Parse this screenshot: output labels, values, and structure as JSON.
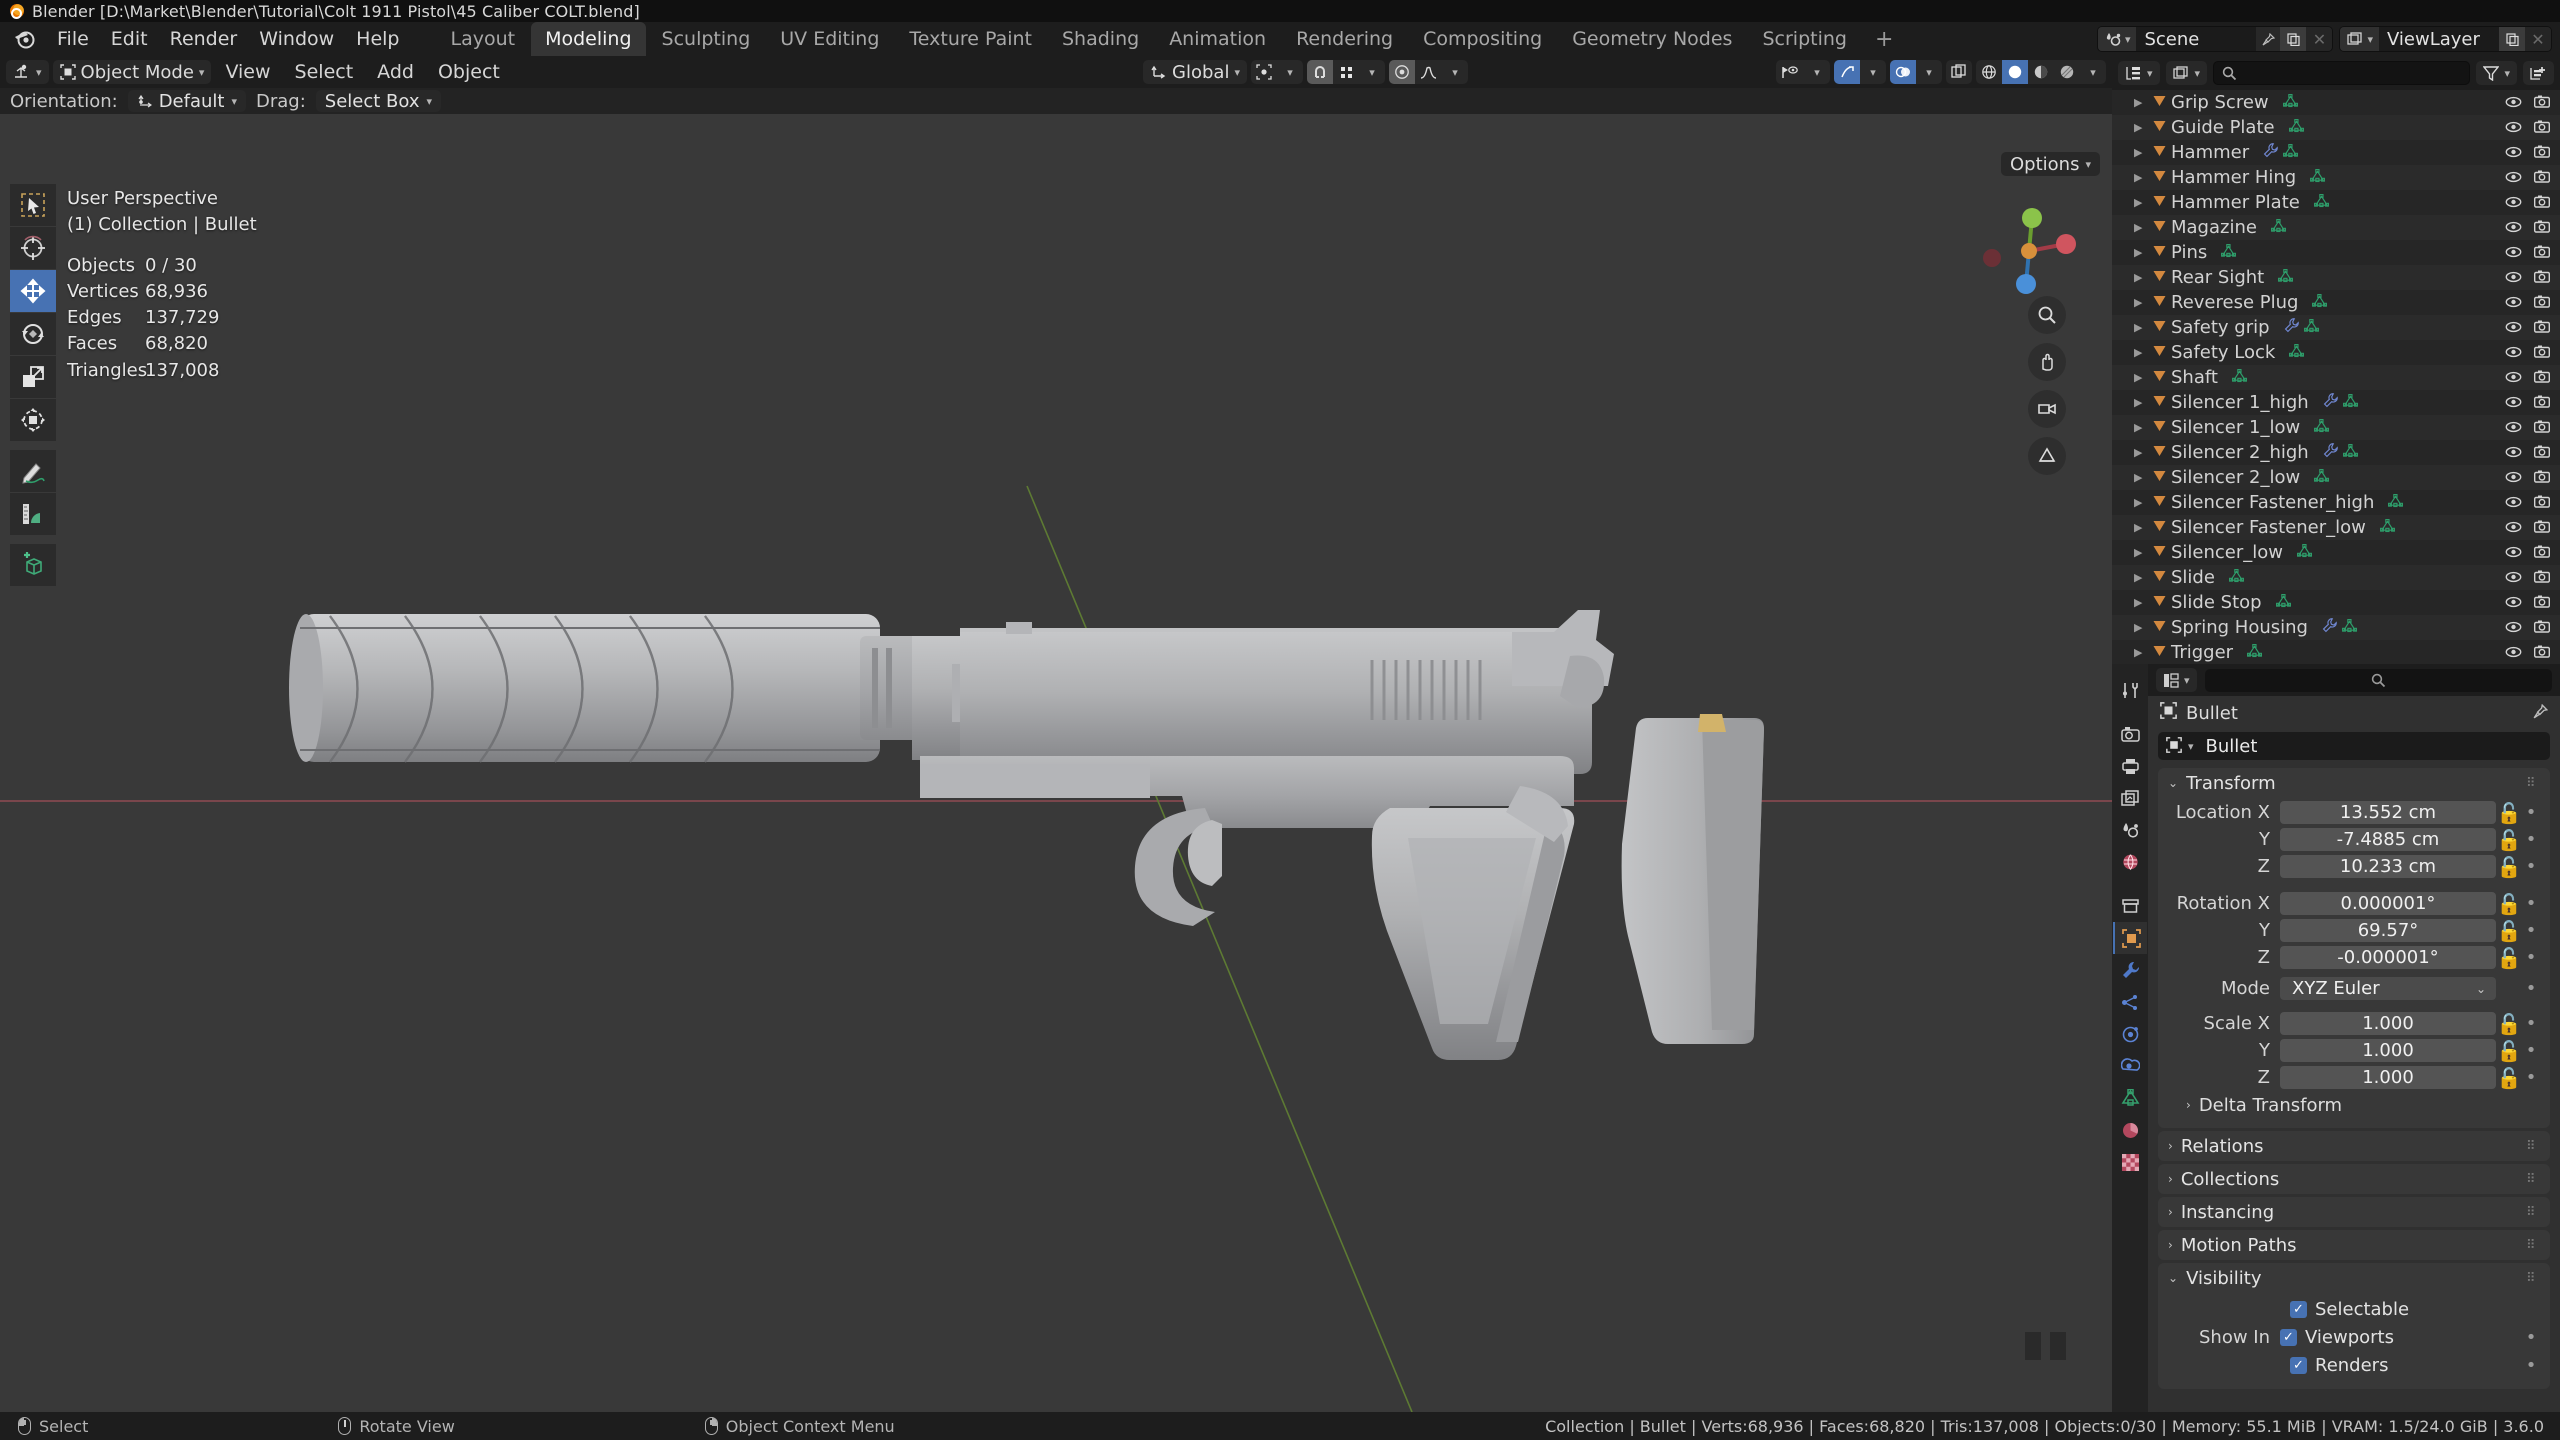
{
  "window": {
    "title": "Blender [D:\\Market\\Blender\\Tutorial\\Colt 1911 Pistol\\45 Caliber COLT.blend]"
  },
  "topbar": {
    "menus": [
      "File",
      "Edit",
      "Render",
      "Window",
      "Help"
    ],
    "workspaces": [
      "Layout",
      "Modeling",
      "Sculpting",
      "UV Editing",
      "Texture Paint",
      "Shading",
      "Animation",
      "Rendering",
      "Compositing",
      "Geometry Nodes",
      "Scripting"
    ],
    "active_workspace": "Modeling",
    "add_workspace": "+",
    "scene_name": "Scene",
    "viewlayer_name": "ViewLayer"
  },
  "viewport": {
    "header": {
      "mode": "Object Mode",
      "menus": [
        "View",
        "Select",
        "Add",
        "Object"
      ],
      "orientation_value": "Global"
    },
    "tool_settings": {
      "orientation_label": "Orientation:",
      "orientation_value": "Default",
      "drag_label": "Drag:",
      "drag_value": "Select Box"
    },
    "options_label": "Options",
    "overlay": {
      "perspective": "User Perspective",
      "collection": "(1) Collection | Bullet",
      "stats": [
        {
          "key": "Objects",
          "value": "0 / 30"
        },
        {
          "key": "Vertices",
          "value": "68,936"
        },
        {
          "key": "Edges",
          "value": "137,729"
        },
        {
          "key": "Faces",
          "value": "68,820"
        },
        {
          "key": "Triangles",
          "value": "137,008"
        }
      ]
    },
    "tools": [
      {
        "name": "tweak-select-tool",
        "active": false
      },
      {
        "name": "cursor-tool",
        "active": false
      },
      {
        "name": "move-tool",
        "active": true
      },
      {
        "name": "rotate-tool",
        "active": false
      },
      {
        "name": "scale-tool",
        "active": false
      },
      {
        "name": "transform-tool",
        "active": false
      },
      {
        "name": "annotate-tool",
        "active": false
      },
      {
        "name": "measure-tool",
        "active": false
      },
      {
        "name": "add-cube-tool",
        "active": false
      }
    ]
  },
  "outliner": {
    "search_placeholder": "",
    "items": [
      {
        "name": "Grip Screw",
        "modifier": false
      },
      {
        "name": "Guide Plate",
        "modifier": false
      },
      {
        "name": "Hammer",
        "modifier": true
      },
      {
        "name": "Hammer Hing",
        "modifier": false
      },
      {
        "name": "Hammer Plate",
        "modifier": false
      },
      {
        "name": "Magazine",
        "modifier": false
      },
      {
        "name": "Pins",
        "modifier": false
      },
      {
        "name": "Rear Sight",
        "modifier": false
      },
      {
        "name": "Reverese Plug",
        "modifier": false
      },
      {
        "name": "Safety grip",
        "modifier": true
      },
      {
        "name": "Safety Lock",
        "modifier": false
      },
      {
        "name": "Shaft",
        "modifier": false
      },
      {
        "name": "Silencer 1_high",
        "modifier": true
      },
      {
        "name": "Silencer 1_low",
        "modifier": false
      },
      {
        "name": "Silencer 2_high",
        "modifier": true
      },
      {
        "name": "Silencer 2_low",
        "modifier": false
      },
      {
        "name": "Silencer Fastener_high",
        "modifier": false
      },
      {
        "name": "Silencer Fastener_low",
        "modifier": false
      },
      {
        "name": "Silencer_low",
        "modifier": false
      },
      {
        "name": "Slide",
        "modifier": false
      },
      {
        "name": "Slide Stop",
        "modifier": false
      },
      {
        "name": "Spring Housing",
        "modifier": true
      },
      {
        "name": "Trigger",
        "modifier": false
      }
    ]
  },
  "properties": {
    "breadcrumb_object": "Bullet",
    "id_name": "Bullet",
    "transform": {
      "title": "Transform",
      "location_label": "Location X",
      "location": [
        {
          "axis": "Location X",
          "value": "13.552 cm"
        },
        {
          "axis": "Y",
          "value": "-7.4885 cm"
        },
        {
          "axis": "Z",
          "value": "10.233 cm"
        }
      ],
      "rotation": [
        {
          "axis": "Rotation X",
          "value": "0.000001°"
        },
        {
          "axis": "Y",
          "value": "69.57°"
        },
        {
          "axis": "Z",
          "value": "-0.000001°"
        }
      ],
      "mode_label": "Mode",
      "mode_value": "XYZ Euler",
      "scale": [
        {
          "axis": "Scale X",
          "value": "1.000"
        },
        {
          "axis": "Y",
          "value": "1.000"
        },
        {
          "axis": "Z",
          "value": "1.000"
        }
      ],
      "delta_transform": "Delta Transform"
    },
    "panels": [
      "Relations",
      "Collections",
      "Instancing",
      "Motion Paths"
    ],
    "visibility": {
      "title": "Visibility",
      "selectable_label": "Selectable",
      "show_in_label": "Show In",
      "viewports_label": "Viewports",
      "renders_label": "Renders"
    }
  },
  "statusbar": {
    "left": [
      {
        "icon": "mouse-left-icon",
        "label": "Select"
      },
      {
        "icon": "mouse-middle-icon",
        "label": "Rotate View"
      },
      {
        "icon": "mouse-right-icon",
        "label": "Object Context Menu"
      }
    ],
    "right": "Collection | Bullet | Verts:68,936 | Faces:68,820 | Tris:137,008 | Objects:0/30 | Memory: 55.1 MiB | VRAM: 1.5/24.0 GiB | 3.6.0"
  },
  "colors": {
    "accent": "#4772b3",
    "mesh_icon": "#2e9e6b",
    "object_icon": "#d4893f",
    "modifier_icon": "#6f86cf"
  }
}
